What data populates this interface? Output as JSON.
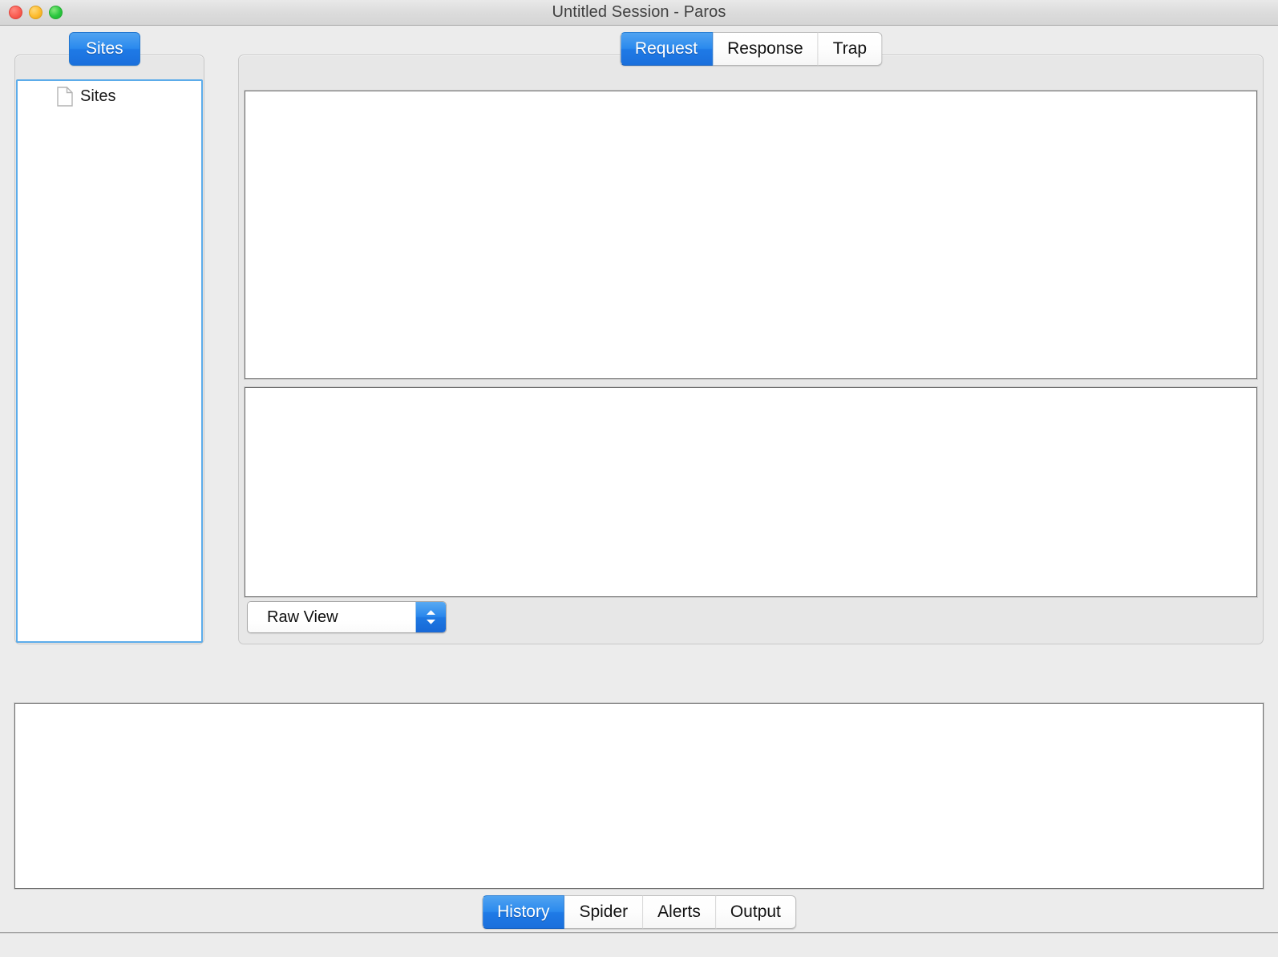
{
  "window": {
    "title": "Untitled Session - Paros",
    "traffic_lights": [
      {
        "name": "close",
        "color": "#fa5e53"
      },
      {
        "name": "minimize",
        "color": "#fdbc2e"
      },
      {
        "name": "maximize",
        "color": "#2ac73f"
      }
    ]
  },
  "sidebar": {
    "tab_label": "Sites",
    "tree": [
      {
        "icon": "file-icon",
        "label": "Sites"
      }
    ]
  },
  "main": {
    "tabs": [
      {
        "label": "Request",
        "active": true
      },
      {
        "label": "Response",
        "active": false
      },
      {
        "label": "Trap",
        "active": false
      }
    ],
    "request_header_text": "",
    "request_body_text": "",
    "view_select": {
      "value": "Raw View",
      "stepper_icon": "chevron-up-down-icon"
    }
  },
  "bottom": {
    "content_text": "",
    "tabs": [
      {
        "label": "History",
        "active": true
      },
      {
        "label": "Spider",
        "active": false
      },
      {
        "label": "Alerts",
        "active": false
      },
      {
        "label": "Output",
        "active": false
      }
    ]
  },
  "colors": {
    "accent_blue": "#1f7ae6",
    "focus_ring": "#5cacea",
    "window_bg": "#ececec",
    "panel_bg": "#e7e7e7",
    "field_bg": "#ffffff",
    "field_border": "#6f6f6f"
  }
}
